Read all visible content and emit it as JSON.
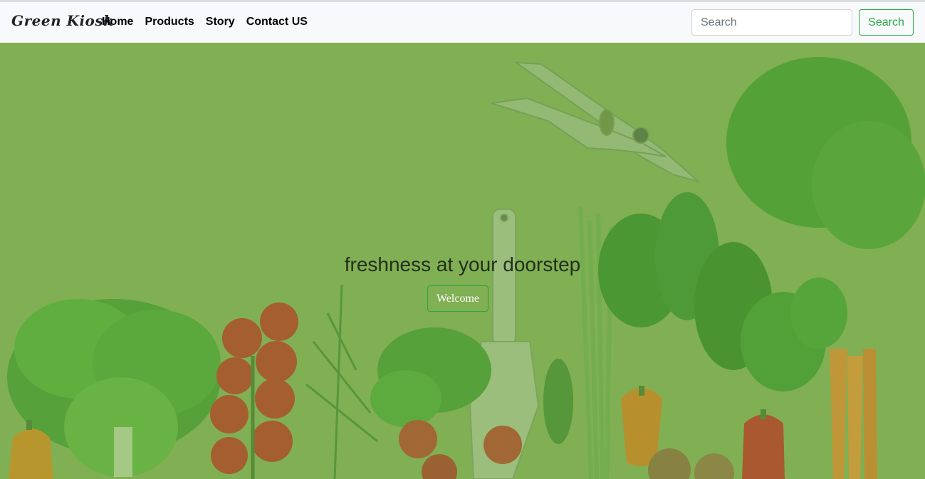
{
  "navbar": {
    "brand": "Green Kiosk",
    "links": [
      {
        "label": "Home"
      },
      {
        "label": "Products"
      },
      {
        "label": "Story"
      },
      {
        "label": "Contact US"
      }
    ],
    "search": {
      "placeholder": "Search",
      "button_label": "Search"
    }
  },
  "hero": {
    "tagline": "freshness at your doorstep",
    "button_label": "Welcome"
  },
  "colors": {
    "accent": "#28a745",
    "hero_overlay": "#82af53",
    "navbar_bg": "#f8f9fa"
  }
}
